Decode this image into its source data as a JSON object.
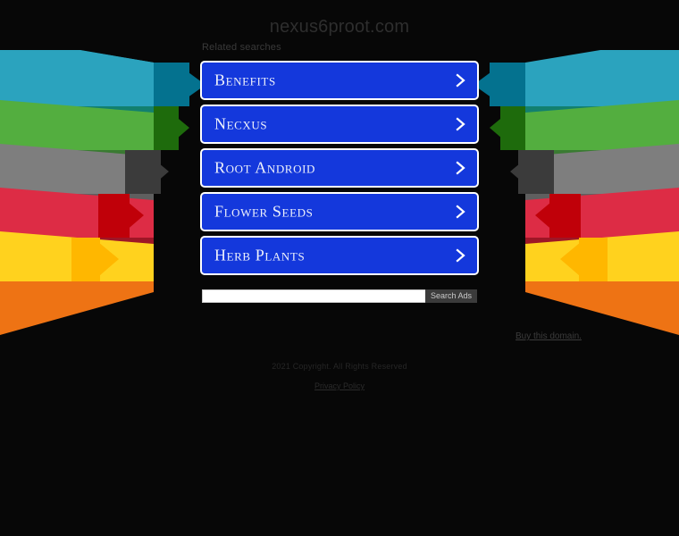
{
  "site": {
    "title": "nexus6proot.com",
    "background_color": "#070707"
  },
  "related": {
    "label": "Related searches"
  },
  "ads": {
    "accent_color": "#1438DC",
    "border_color": "#ffffff",
    "chevron_icon": "chevron-right-icon",
    "items": [
      {
        "label": "Benefits"
      },
      {
        "label": "Necxus"
      },
      {
        "label": "Root Android"
      },
      {
        "label": "Flower Seeds"
      },
      {
        "label": "Herb Plants"
      }
    ]
  },
  "search": {
    "value": "",
    "placeholder": "",
    "button_label": "Search Ads",
    "button_color": "#3b3b3b"
  },
  "footer": {
    "buy_domain": "Buy this domain.",
    "copyright": "2021 Copyright. All Rights Reserved",
    "privacy_policy": "Privacy Policy"
  },
  "decoration": {
    "name": "arrow-bands",
    "rows": [
      {
        "name": "teal",
        "tail_color": "#2BA3BE",
        "tail_shade": "#12806F",
        "body_color": "#04728F"
      },
      {
        "name": "green",
        "tail_color": "#53AE3F",
        "tail_shade": "#3A7A32",
        "body_color": "#1E6B0C"
      },
      {
        "name": "gray",
        "tail_color": "#7E7E7E",
        "tail_shade": "#5F5F5F",
        "body_color": "#3B3B3B"
      },
      {
        "name": "red",
        "tail_color": "#DD2C45",
        "tail_shade": "#9E1626",
        "body_color": "#C00009"
      },
      {
        "name": "gold",
        "tail_color": "#FFD21E",
        "tail_shade": "#EE7314",
        "body_color": "#FFB700"
      }
    ]
  }
}
